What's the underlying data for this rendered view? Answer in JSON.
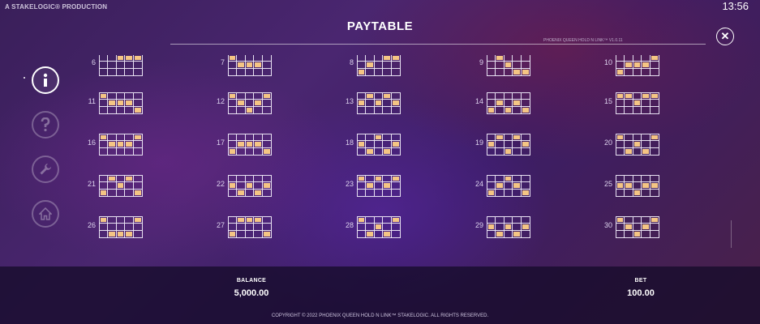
{
  "header": {
    "brand": "A STAKELOGIC® PRODUCTION",
    "clock": "13:56",
    "title": "PAYTABLE",
    "version": "PHOENIX QUEEN HOLD N LINK™ V1.0.11"
  },
  "nav": [
    {
      "name": "info-button",
      "icon": "info-icon",
      "active": true
    },
    {
      "name": "help-button",
      "icon": "question-icon",
      "active": false
    },
    {
      "name": "settings-button",
      "icon": "wrench-icon",
      "active": false
    },
    {
      "name": "home-button",
      "icon": "home-icon",
      "active": false
    }
  ],
  "close_icon": "close-icon",
  "highlight_color": "#f4c584",
  "paylines": [
    {
      "number": "6",
      "pattern": [
        "00111",
        "00000",
        "00000"
      ],
      "clip": true
    },
    {
      "number": "7",
      "pattern": [
        "10000",
        "01110",
        "00000"
      ],
      "clip": true
    },
    {
      "number": "8",
      "pattern": [
        "00011",
        "01000",
        "10000"
      ],
      "clip": true
    },
    {
      "number": "9",
      "pattern": [
        "01000",
        "00100",
        "00011"
      ],
      "clip": true
    },
    {
      "number": "10",
      "pattern": [
        "00001",
        "01110",
        "10000"
      ],
      "clip": true
    },
    {
      "number": "11",
      "pattern": [
        "10000",
        "01110",
        "00001"
      ],
      "clip": false
    },
    {
      "number": "12",
      "pattern": [
        "10001",
        "01010",
        "00100"
      ],
      "clip": false
    },
    {
      "number": "13",
      "pattern": [
        "01010",
        "10101",
        "00000"
      ],
      "clip": false
    },
    {
      "number": "14",
      "pattern": [
        "00000",
        "01010",
        "10101"
      ],
      "clip": false
    },
    {
      "number": "15",
      "pattern": [
        "11011",
        "00100",
        "00000"
      ],
      "clip": false
    },
    {
      "number": "16",
      "pattern": [
        "10001",
        "01110",
        "00000"
      ],
      "clip": false
    },
    {
      "number": "17",
      "pattern": [
        "00000",
        "01110",
        "10001"
      ],
      "clip": false
    },
    {
      "number": "18",
      "pattern": [
        "00100",
        "10001",
        "01010"
      ],
      "clip": false
    },
    {
      "number": "19",
      "pattern": [
        "01010",
        "10001",
        "00100"
      ],
      "clip": false
    },
    {
      "number": "20",
      "pattern": [
        "10001",
        "00100",
        "01010"
      ],
      "clip": false
    },
    {
      "number": "21",
      "pattern": [
        "01010",
        "00100",
        "10001"
      ],
      "clip": false
    },
    {
      "number": "22",
      "pattern": [
        "00000",
        "10101",
        "01010"
      ],
      "clip": false
    },
    {
      "number": "23",
      "pattern": [
        "10101",
        "01010",
        "00000"
      ],
      "clip": false
    },
    {
      "number": "24",
      "pattern": [
        "00100",
        "01010",
        "10001"
      ],
      "clip": false
    },
    {
      "number": "25",
      "pattern": [
        "00000",
        "11011",
        "00100"
      ],
      "clip": false
    },
    {
      "number": "26",
      "pattern": [
        "10001",
        "00000",
        "01110"
      ],
      "clip": false
    },
    {
      "number": "27",
      "pattern": [
        "01110",
        "00000",
        "10001"
      ],
      "clip": false
    },
    {
      "number": "28",
      "pattern": [
        "10001",
        "00100",
        "01010"
      ],
      "clip": false
    },
    {
      "number": "29",
      "pattern": [
        "00000",
        "10101",
        "01010"
      ],
      "clip": false
    },
    {
      "number": "30",
      "pattern": [
        "10001",
        "01010",
        "00100"
      ],
      "clip": false
    }
  ],
  "footer": {
    "balance_label": "BALANCE",
    "balance_value": "5,000.00",
    "bet_label": "BET",
    "bet_value": "100.00",
    "copyright": "COPYRIGHT © 2022 PHOENIX QUEEN HOLD N LINK™ STAKELOGIC. ALL RIGHTS RESERVED."
  }
}
